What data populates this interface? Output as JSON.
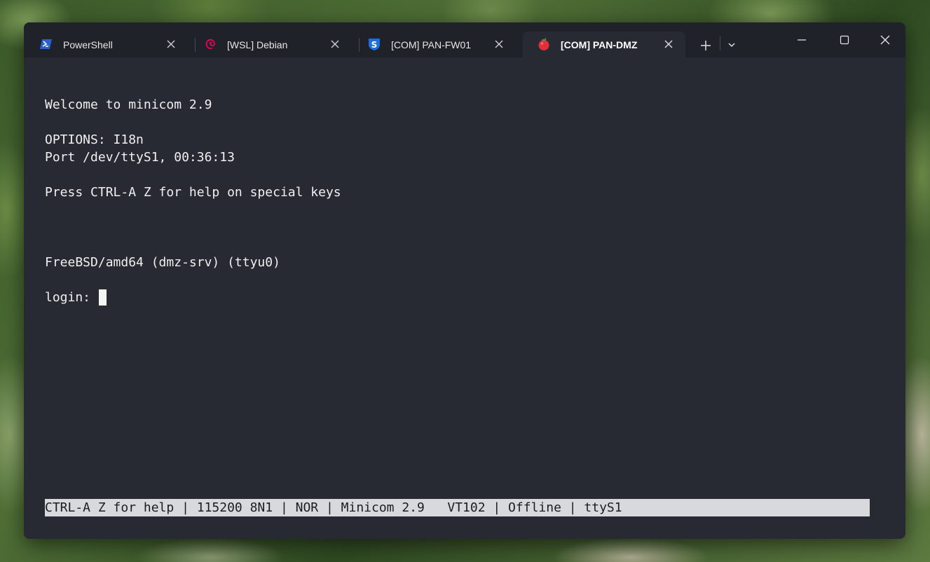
{
  "window": {
    "tabs": [
      {
        "label": "PowerShell",
        "icon": "powershell-icon",
        "active": false
      },
      {
        "label": "[WSL] Debian",
        "icon": "debian-swirl-icon",
        "active": false
      },
      {
        "label": "[COM] PAN-FW01",
        "icon": "blue-shield-s-icon",
        "active": false
      },
      {
        "label": "[COM] PAN-DMZ",
        "icon": "red-berry-icon",
        "active": true
      }
    ],
    "new_tab_glyph": "+",
    "dropdown_glyph": "chevron-down-icon"
  },
  "terminal": {
    "lines": [
      "Welcome to minicom 2.9",
      "",
      "OPTIONS: I18n",
      "Port /dev/ttyS1, 00:36:13",
      "",
      "Press CTRL-A Z for help on special keys",
      "",
      "",
      "",
      "FreeBSD/amd64 (dmz-srv) (ttyu0)",
      "",
      "login: "
    ],
    "status_bar": "CTRL-A Z for help | 115200 8N1 | NOR | Minicom 2.9   VT102 | Offline | ttyS1"
  },
  "colors": {
    "terminal_bg": "#272a33",
    "tab_strip_bg": "#1f2228",
    "terminal_fg": "#f0f0f0",
    "status_bg": "#d7d9dd",
    "powershell_blue": "#2b5fcc",
    "debian_red": "#d70751",
    "shield_blue": "#1a6fe0",
    "berry_red": "#e0303a"
  }
}
